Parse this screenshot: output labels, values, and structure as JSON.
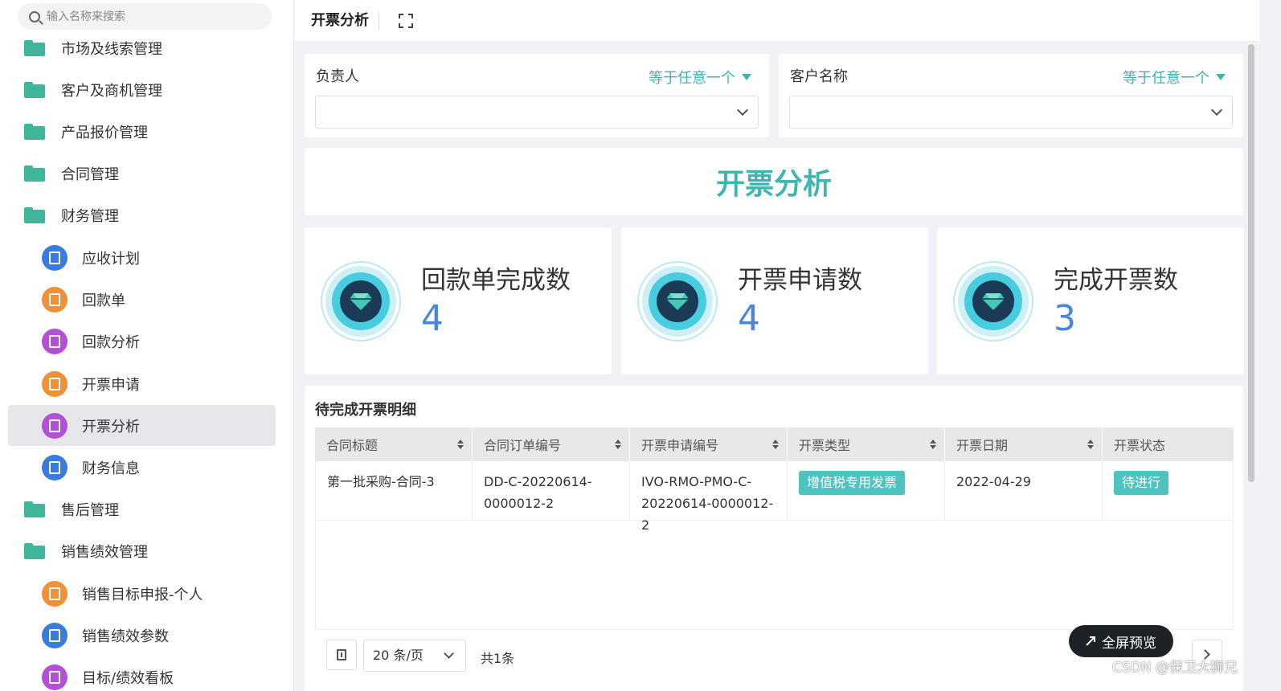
{
  "sidebar": {
    "search_placeholder": "输入名称来搜索",
    "items": [
      {
        "label": "市场及线索管理",
        "type": "folder"
      },
      {
        "label": "客户及商机管理",
        "type": "folder"
      },
      {
        "label": "产品报价管理",
        "type": "folder"
      },
      {
        "label": "合同管理",
        "type": "folder"
      },
      {
        "label": "财务管理",
        "type": "folder"
      },
      {
        "label": "应收计划",
        "type": "sub",
        "color": "#3a7be0"
      },
      {
        "label": "回款单",
        "type": "sub",
        "color": "#f0913a"
      },
      {
        "label": "回款分析",
        "type": "sub",
        "color": "#b44fd8"
      },
      {
        "label": "开票申请",
        "type": "sub",
        "color": "#f0913a"
      },
      {
        "label": "开票分析",
        "type": "sub",
        "color": "#b44fd8",
        "active": true
      },
      {
        "label": "财务信息",
        "type": "sub",
        "color": "#3a7be0"
      },
      {
        "label": "售后管理",
        "type": "folder"
      },
      {
        "label": "销售绩效管理",
        "type": "folder"
      },
      {
        "label": "销售目标申报-个人",
        "type": "sub",
        "color": "#f0913a"
      },
      {
        "label": "销售绩效参数",
        "type": "sub",
        "color": "#3a7be0"
      },
      {
        "label": "目标/绩效看板",
        "type": "sub",
        "color": "#b44fd8"
      }
    ]
  },
  "header": {
    "title": "开票分析"
  },
  "filters": [
    {
      "label": "负责人",
      "mode": "等于任意一个",
      "value": ""
    },
    {
      "label": "客户名称",
      "mode": "等于任意一个",
      "value": ""
    }
  ],
  "banner": {
    "title": "开票分析"
  },
  "stats": [
    {
      "title": "回款单完成数",
      "value": "4"
    },
    {
      "title": "开票申请数",
      "value": "4"
    },
    {
      "title": "完成开票数",
      "value": "3"
    }
  ],
  "table": {
    "title": "待完成开票明细",
    "columns": [
      "合同标题",
      "合同订单编号",
      "开票申请编号",
      "开票类型",
      "开票日期",
      "开票状态"
    ],
    "rows": [
      {
        "contract_title": "第一批采购-合同-3",
        "order_no": "DD-C-20220614-0000012-2",
        "invoice_apply_no": "IVO-RMO-PMO-C-20220614-0000012-2",
        "invoice_type": "增值税专用发票",
        "invoice_date": "2022-04-29",
        "invoice_status": "待进行"
      }
    ]
  },
  "pagination": {
    "page_size": "20 条/页",
    "total": "共1条"
  },
  "fullscreen_button": "全屏预览",
  "watermark": "CSDN @保卫大狮兄",
  "colors": {
    "accent": "#3fb5b0",
    "stat_number": "#4a86d8",
    "folder": "#3fb59c"
  }
}
